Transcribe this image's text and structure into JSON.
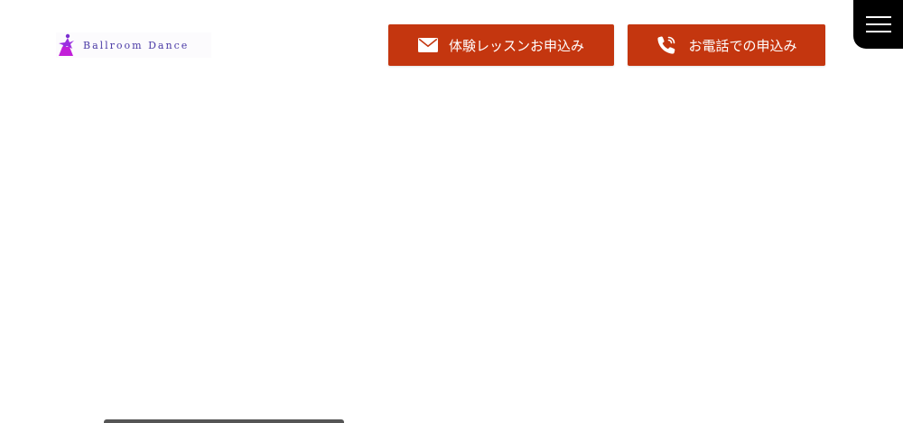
{
  "header": {
    "logo": {
      "text": "Ballroom Dance",
      "icon": "dancer-silhouette-icon"
    },
    "cta_buttons": [
      {
        "label": "体験レッスンお申込み",
        "icon": "envelope-icon"
      },
      {
        "label": "お電話での申込み",
        "icon": "phone-icon"
      }
    ],
    "menu": {
      "icon": "hamburger-menu-icon"
    }
  },
  "colors": {
    "cta_background": "#c4360f",
    "menu_background": "#000000",
    "logo_text": "#4a3aa6",
    "logo_accent": "#c21fd8"
  }
}
